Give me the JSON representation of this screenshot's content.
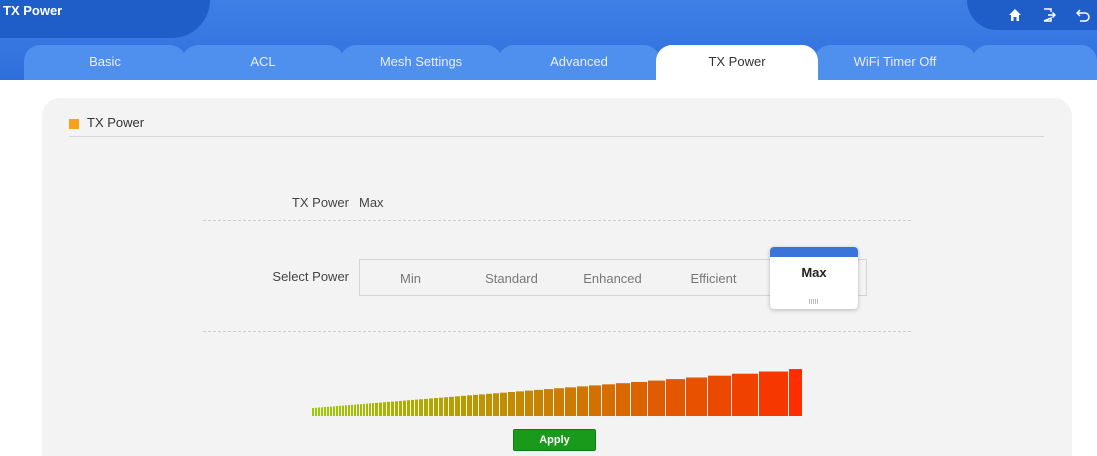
{
  "window": {
    "title": "TX Power"
  },
  "header_icons": [
    {
      "name": "home-icon"
    },
    {
      "name": "logout-icon"
    },
    {
      "name": "back-icon"
    }
  ],
  "tabs": [
    {
      "label": "Basic",
      "active": false
    },
    {
      "label": "ACL",
      "active": false
    },
    {
      "label": "Mesh Settings",
      "active": false
    },
    {
      "label": "Advanced",
      "active": false
    },
    {
      "label": "TX Power",
      "active": true
    },
    {
      "label": "WiFi Timer Off",
      "active": false
    }
  ],
  "section": {
    "title": "TX Power"
  },
  "tx_power": {
    "label": "TX Power",
    "value": "Max"
  },
  "select_power": {
    "label": "Select Power",
    "options": [
      "Min",
      "Standard",
      "Enhanced",
      "Efficient",
      "Max"
    ],
    "selected": "Max"
  },
  "apply_button": {
    "label": "Apply"
  },
  "colors": {
    "accent_blue": "#2f6fdc",
    "section_marker": "#f5a21c",
    "apply_green": "#1a9a1a",
    "bar_start": "#9acd00",
    "bar_end": "#ff2a00"
  }
}
